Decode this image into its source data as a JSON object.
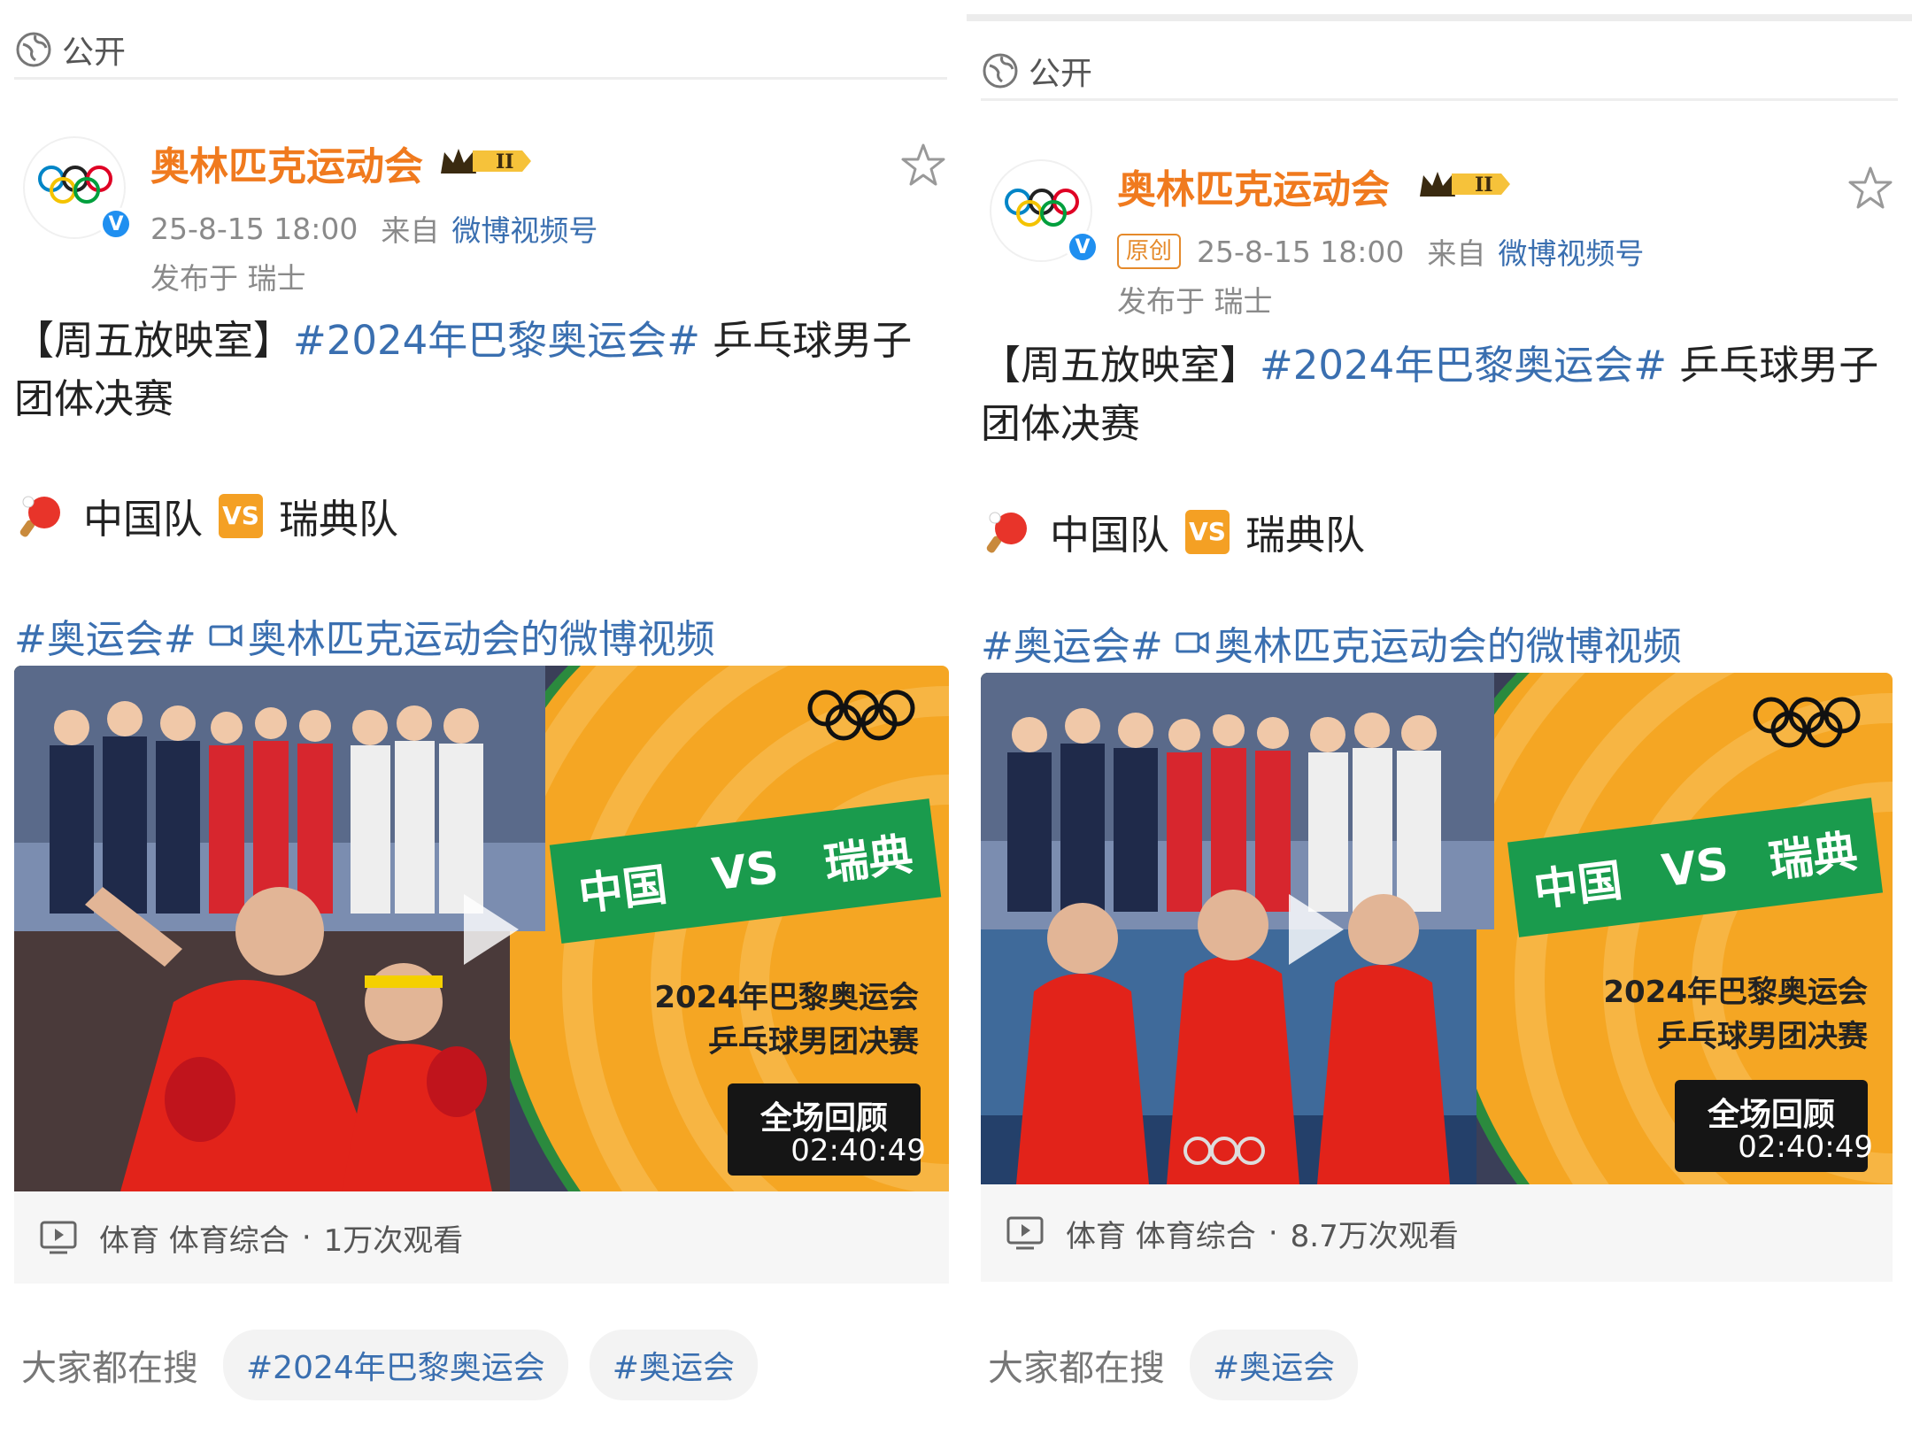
{
  "panels": [
    {
      "visibility": "公开",
      "author": "奥林匹克运动会",
      "original_tag": "",
      "timestamp": "25-8-15 18:00",
      "from_label": "来自",
      "source": "微博视频号",
      "location": "发布于 瑞士",
      "post": {
        "prefix": "【周五放映室】",
        "hashtag": "#2024年巴黎奥运会#",
        "suffix": " 乒乓球男子团体决赛"
      },
      "match": {
        "team_a": "中国队",
        "vs": "VS",
        "team_b": "瑞典队"
      },
      "topic": {
        "hashtag": "#奥运会#",
        "video_link": "奥林匹克运动会的微博视频"
      },
      "video": {
        "headline_a": "中国",
        "headline_vs": "VS",
        "headline_b": "瑞典",
        "subtitle_line1": "2024年巴黎奥运会",
        "subtitle_line2": "乒乓球男团决赛",
        "replay": "全场回顾",
        "duration": "02:40:49",
        "category": "体育 体育综合",
        "views": "1万次观看"
      },
      "trending": {
        "label": "大家都在搜",
        "chips": [
          "#2024年巴黎奥运会",
          "#奥运会"
        ]
      }
    },
    {
      "visibility": "公开",
      "author": "奥林匹克运动会",
      "original_tag": "原创",
      "timestamp": "25-8-15 18:00",
      "from_label": "来自",
      "source": "微博视频号",
      "location": "发布于 瑞士",
      "post": {
        "prefix": "【周五放映室】",
        "hashtag": "#2024年巴黎奥运会#",
        "suffix": " 乒乓球男子团体决赛"
      },
      "match": {
        "team_a": "中国队",
        "vs": "VS",
        "team_b": "瑞典队"
      },
      "topic": {
        "hashtag": "#奥运会#",
        "video_link": "奥林匹克运动会的微博视频"
      },
      "video": {
        "headline_a": "中国",
        "headline_vs": "VS",
        "headline_b": "瑞典",
        "subtitle_line1": "2024年巴黎奥运会",
        "subtitle_line2": "乒乓球男团决赛",
        "replay": "全场回顾",
        "duration": "02:40:49",
        "category": "体育 体育综合",
        "views": "8.7万次观看"
      },
      "trending": {
        "label": "大家都在搜",
        "chips": [
          "#奥运会"
        ]
      }
    }
  ],
  "colors": {
    "author": "#f07a1e",
    "link": "#3a6fb0",
    "video_orange": "#f5a623",
    "headline_green": "#1a9b4d",
    "verified": "#1f8ff0"
  },
  "icons": {
    "visibility": "globe-icon",
    "verified": "verified-badge-icon",
    "vip": "crown-vip-icon",
    "star": "star-outline-icon",
    "sport": "ping-pong-paddle-icon",
    "vs": "vs-icon",
    "video_link": "video-link-icon",
    "play": "play-icon",
    "video_category": "video-play-box-icon"
  }
}
